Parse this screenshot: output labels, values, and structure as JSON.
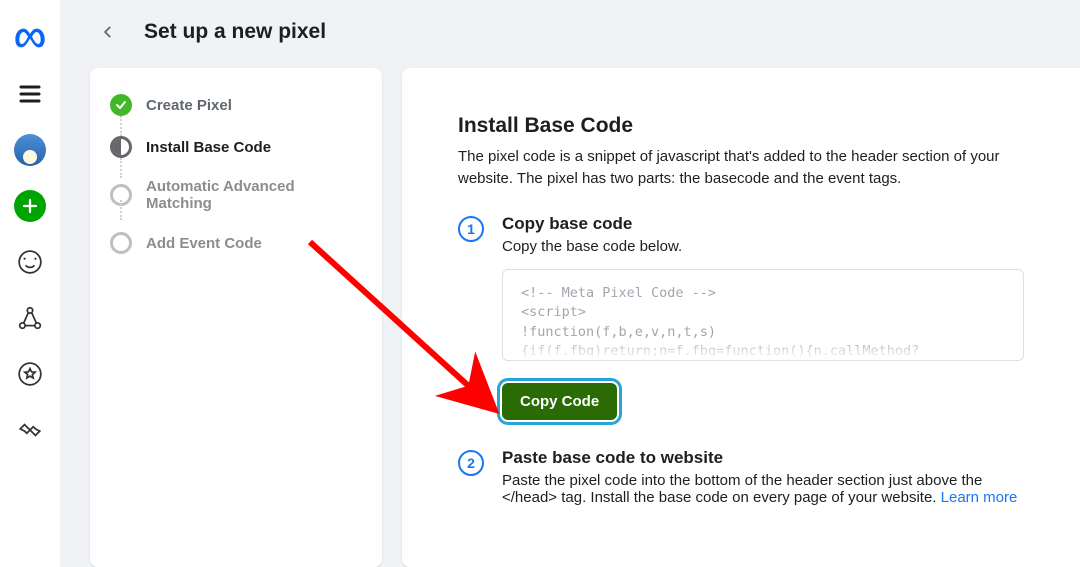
{
  "header": {
    "title": "Set up a new pixel"
  },
  "stepper": {
    "items": [
      {
        "label": "Create Pixel"
      },
      {
        "label": "Install Base Code"
      },
      {
        "label": "Automatic Advanced Matching"
      },
      {
        "label": "Add Event Code"
      }
    ]
  },
  "main": {
    "title": "Install Base Code",
    "description": "The pixel code is a snippet of javascript that's added to the header section of your website. The pixel has two parts: the basecode and the event tags.",
    "step1": {
      "number": "1",
      "title": "Copy base code",
      "subtitle": "Copy the base code below.",
      "code": "<!-- Meta Pixel Code -->\n<script>\n!function(f,b,e,v,n,t,s)\n{if(f.fbq)return;n=f.fbq=function(){n.callMethod?\nn.callMethod.apply(n,arguments):n.queue.push(arguments)};",
      "copy_label": "Copy Code"
    },
    "step2": {
      "number": "2",
      "title": "Paste base code to website",
      "desc_before": "Paste the pixel code into the bottom of the header section just above the </head> tag. Install the base code on every page of your website. ",
      "learn_more": "Learn more"
    }
  },
  "rail": {
    "icons": {
      "meta": "meta-logo",
      "menu": "menu",
      "avatar": "avatar",
      "plus": "add",
      "gauge": "gauge",
      "graph": "graph-nodes",
      "star": "star-circle",
      "diamond": "handshake"
    }
  }
}
